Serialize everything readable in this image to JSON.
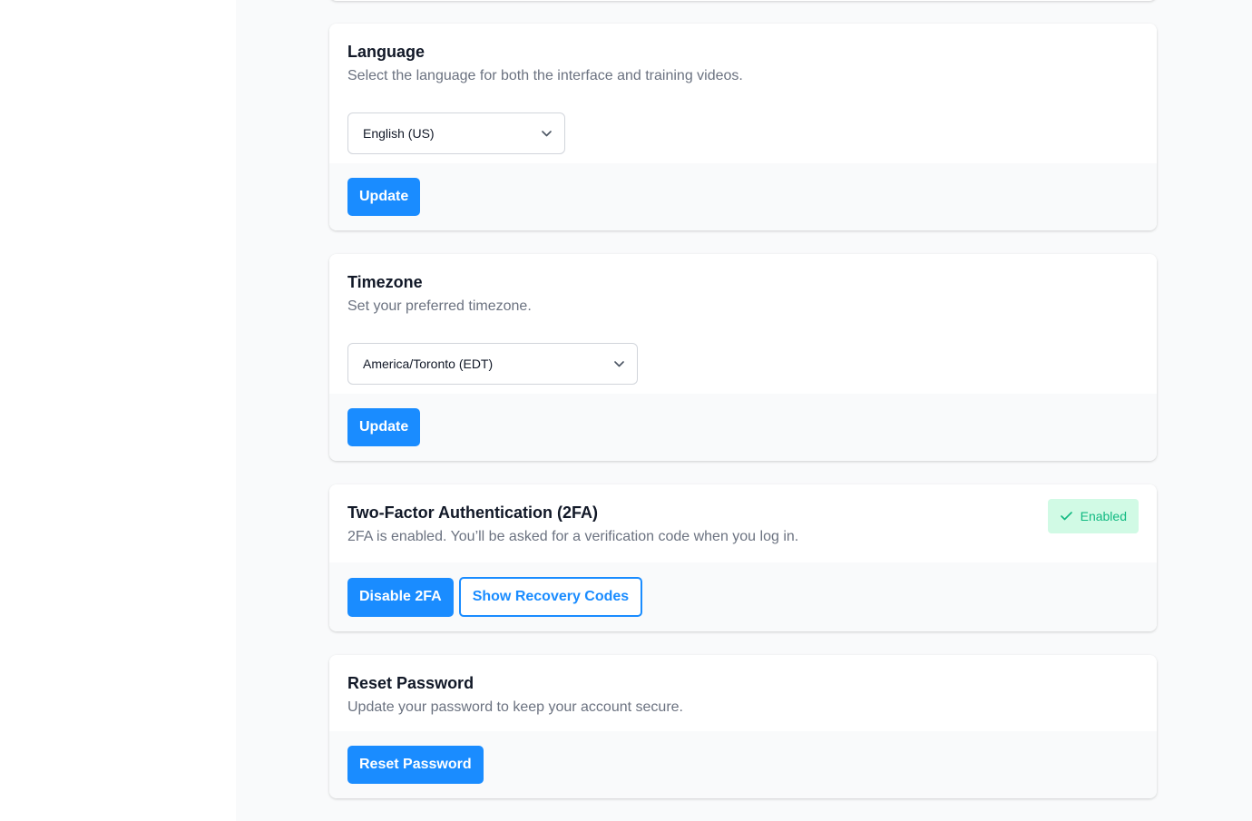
{
  "language": {
    "title": "Language",
    "description": "Select the language for both the interface and training videos.",
    "selected": "English (US)",
    "button": "Update"
  },
  "timezone": {
    "title": "Timezone",
    "description": "Set your preferred timezone.",
    "selected": "America/Toronto (EDT)",
    "button": "Update"
  },
  "twofa": {
    "title": "Two-Factor Authentication (2FA)",
    "description": "2FA is enabled. You’ll be asked for a verification code when you log in.",
    "badge": "Enabled",
    "disable_button": "Disable 2FA",
    "recovery_button": "Show Recovery Codes"
  },
  "reset_password": {
    "title": "Reset Password",
    "description": "Update your password to keep your account secure.",
    "button": "Reset Password"
  },
  "colors": {
    "primary": "#1a8cff",
    "success_bg": "#d1fae5",
    "success_text": "#10b981"
  },
  "icons": {
    "select_chevron": "chevron-down-icon",
    "badge_check": "check-icon"
  }
}
